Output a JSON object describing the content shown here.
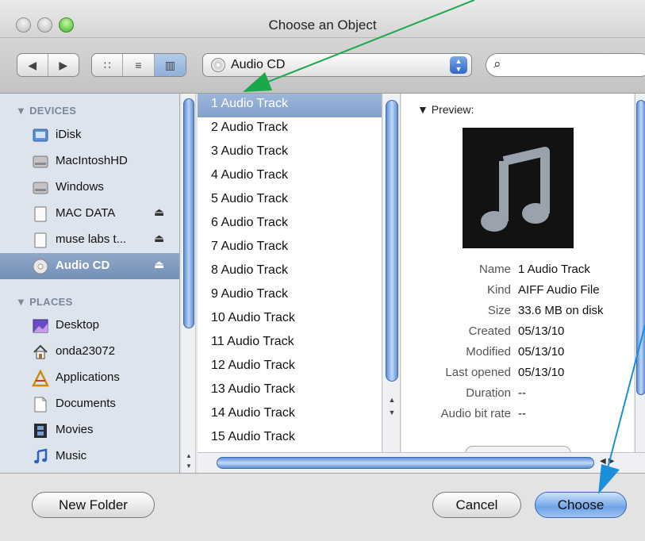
{
  "window": {
    "title": "Choose an Object"
  },
  "toolbar": {
    "back_icon": "◀",
    "forward_icon": "▶",
    "view_icons": [
      "∷",
      "≡",
      "▥"
    ],
    "location_label": "Audio CD",
    "location_arrows": "▲\n▼",
    "search_placeholder": "",
    "search_icon": "⌕"
  },
  "sidebar": {
    "devices_header": "▼ DEVICES",
    "places_header": "▼ PLACES",
    "devices": [
      {
        "label": "iDisk",
        "icon": "idisk-icon",
        "eject": ""
      },
      {
        "label": "MacIntoshHD",
        "icon": "hard-drive-icon",
        "eject": ""
      },
      {
        "label": "Windows",
        "icon": "hard-drive-icon",
        "eject": ""
      },
      {
        "label": "MAC DATA",
        "icon": "external-drive-icon",
        "eject": "⏏"
      },
      {
        "label": "muse labs t...",
        "icon": "external-drive-icon",
        "eject": "⏏"
      },
      {
        "label": "Audio CD",
        "icon": "cd-icon",
        "eject": "⏏"
      }
    ],
    "places": [
      {
        "label": "Desktop",
        "icon": "desktop-icon"
      },
      {
        "label": "onda23072",
        "icon": "home-icon"
      },
      {
        "label": "Applications",
        "icon": "applications-icon"
      },
      {
        "label": "Documents",
        "icon": "documents-icon"
      },
      {
        "label": "Movies",
        "icon": "movies-icon"
      },
      {
        "label": "Music",
        "icon": "music-icon"
      }
    ]
  },
  "tracks": [
    "1 Audio Track",
    "2 Audio Track",
    "3 Audio Track",
    "4 Audio Track",
    "5 Audio Track",
    "6 Audio Track",
    "7 Audio Track",
    "8 Audio Track",
    "9 Audio Track",
    "10 Audio Track",
    "11 Audio Track",
    "12 Audio Track",
    "13 Audio Track",
    "14 Audio Track",
    "15 Audio Track"
  ],
  "preview": {
    "title": "▼ Preview:",
    "art_icon": "music-note-icon",
    "fields": [
      {
        "key": "Name",
        "value": "1 Audio Track"
      },
      {
        "key": "Kind",
        "value": "AIFF Audio File"
      },
      {
        "key": "Size",
        "value": "33.6 MB on disk"
      },
      {
        "key": "Created",
        "value": "05/13/10"
      },
      {
        "key": "Modified",
        "value": "05/13/10"
      },
      {
        "key": "Last opened",
        "value": "05/13/10"
      },
      {
        "key": "Duration",
        "value": "--"
      },
      {
        "key": "Audio bit rate",
        "value": "--"
      }
    ]
  },
  "buttons": {
    "new_folder": "New Folder",
    "cancel": "Cancel",
    "choose": "Choose"
  },
  "annotation_colors": {
    "green_arrow": "#1aa84a",
    "blue_arrow": "#1b8fd9"
  }
}
